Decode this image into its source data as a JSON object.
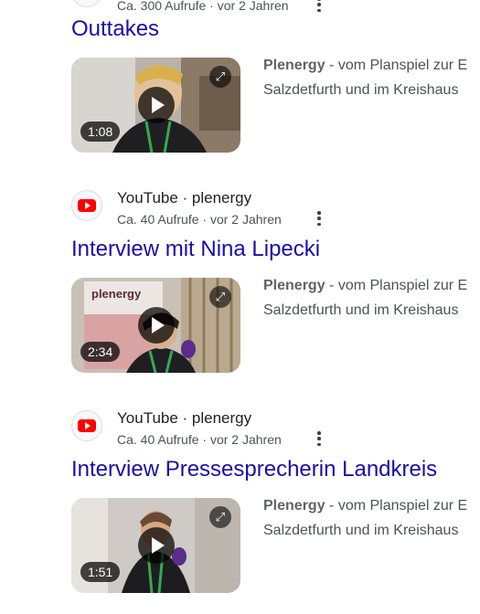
{
  "results": [
    {
      "views": "Ca. 300 Aufrufe",
      "age": "vor 2 Jahren",
      "title": "Outtakes",
      "duration": "1:08",
      "snippet_bold": "Plenergy",
      "snippet_rest": " - vom Planspiel zur E",
      "snippet_line2": "Salzdetfurth und im Kreishaus"
    },
    {
      "source": "YouTube · plenergy",
      "views": "Ca. 40 Aufrufe",
      "age": "vor 2 Jahren",
      "title": "Interview mit Nina Lipecki",
      "duration": "2:34",
      "snippet_bold": "Plenergy",
      "snippet_rest": " - vom Planspiel zur E",
      "snippet_line2": "Salzdetfurth und im Kreishaus"
    },
    {
      "source": "YouTube · plenergy",
      "views": "Ca. 40 Aufrufe",
      "age": "vor 2 Jahren",
      "title": "Interview Pressesprecherin Landkreis",
      "duration": "1:51",
      "snippet_bold": "Plenergy",
      "snippet_rest": " - vom Planspiel zur E",
      "snippet_line2": "Salzdetfurth und im Kreishaus"
    }
  ],
  "separator": " · ",
  "thumb_overlay_text": "plenergy",
  "colors": {
    "title_link": "#1a0dab",
    "youtube_red": "#ff0000",
    "meta_text": "#4d5156"
  }
}
